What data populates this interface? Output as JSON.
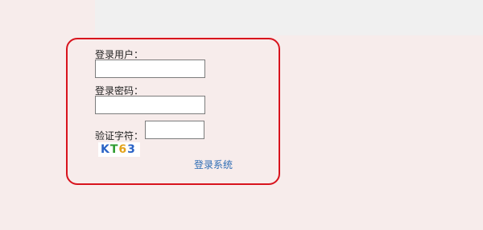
{
  "form": {
    "username_label": "登录用户：",
    "username_value": "",
    "password_label": "登录密码：",
    "password_value": "",
    "captcha_label": "验证字符：",
    "captcha_value": "",
    "captcha_chars": [
      {
        "char": "K",
        "color": "#2a63c6"
      },
      {
        "char": "T",
        "color": "#2f9b2f"
      },
      {
        "char": "6",
        "color": "#e3a21a"
      },
      {
        "char": "3",
        "color": "#2a63c6"
      }
    ],
    "submit_label": "登录系统"
  },
  "colors": {
    "page_bg": "#f7eceb",
    "panel_border": "#d8131d",
    "link": "#2f6db5"
  }
}
